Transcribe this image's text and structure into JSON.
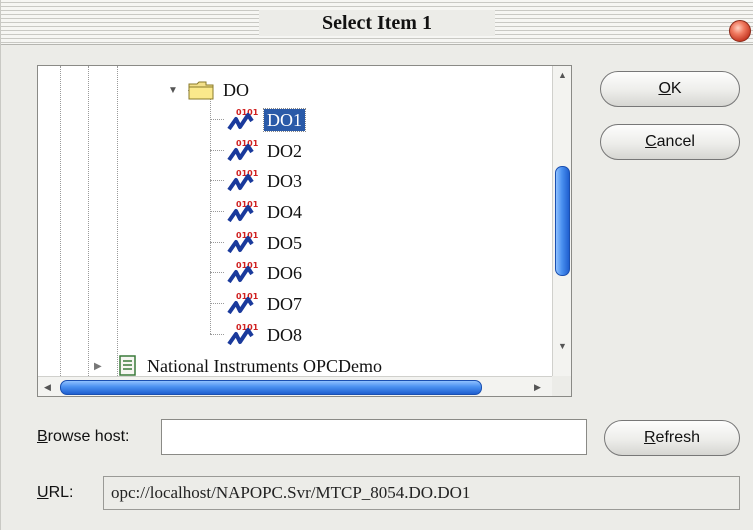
{
  "window": {
    "title": "Select Item 1"
  },
  "tree": {
    "folder": {
      "label": "DO",
      "expander": "▼"
    },
    "items": [
      {
        "label": "DO1",
        "selected": true
      },
      {
        "label": "DO2"
      },
      {
        "label": "DO3"
      },
      {
        "label": "DO4"
      },
      {
        "label": "DO5"
      },
      {
        "label": "DO6"
      },
      {
        "label": "DO7"
      },
      {
        "label": "DO8"
      }
    ],
    "next_node": {
      "label": "National Instruments OPCDemo",
      "expander": "▶"
    }
  },
  "buttons": {
    "ok": {
      "mnemonic": "O",
      "rest": "K"
    },
    "cancel": {
      "mnemonic": "C",
      "rest": "ancel"
    },
    "refresh": {
      "mnemonic": "R",
      "rest": "efresh"
    }
  },
  "browse_host": {
    "mnemonic": "B",
    "rest": "rowse host:",
    "value": ""
  },
  "url": {
    "mnemonic": "U",
    "rest": "RL:",
    "value": "opc://localhost/NAPOPC.Svr/MTCP_8054.DO.DO1"
  },
  "icons": {
    "folder": "folder-icon",
    "tag": "opc-tag-icon",
    "server": "server-document-icon"
  },
  "colors": {
    "selection": "#2a5aa8",
    "scroll_thumb": "#4a90f0",
    "close": "#d0402a"
  }
}
